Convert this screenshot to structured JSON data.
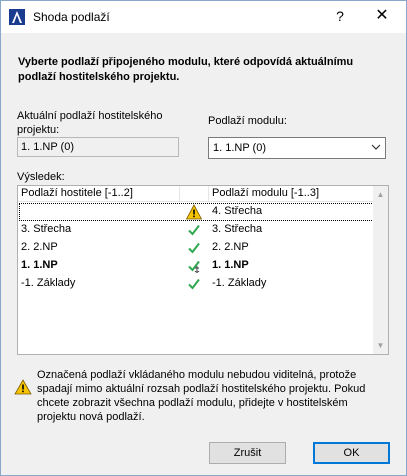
{
  "window": {
    "title": "Shoda podlaží",
    "help_label": "?",
    "close_label": "✕"
  },
  "instruction": "Vyberte podlaží připojeného modulu, které odpovídá aktuálnímu podlaží hostitelského projektu.",
  "current_storey": {
    "label": "Aktuální podlaží hostitelského projektu:",
    "value": "1. 1.NP (0)"
  },
  "module_storey": {
    "label": "Podlaží modulu:",
    "value": "1. 1.NP (0)"
  },
  "results": {
    "label": "Výsledek:",
    "columns": [
      "Podlaží hostitele [-1..2]",
      "Podlaží modulu [-1..3]"
    ],
    "rows": [
      {
        "host": "",
        "status": "warning",
        "module": "4. Střecha",
        "bold": false,
        "focused": true
      },
      {
        "host": "3. Střecha",
        "status": "check",
        "module": "3. Střecha",
        "bold": false,
        "focused": false
      },
      {
        "host": "2. 2.NP",
        "status": "check",
        "module": "2. 2.NP",
        "bold": false,
        "focused": false
      },
      {
        "host": "1. 1.NP",
        "status": "check-anchor",
        "module": "1. 1.NP",
        "bold": true,
        "focused": false
      },
      {
        "host": "-1. Základy",
        "status": "check",
        "module": "-1. Základy",
        "bold": false,
        "focused": false
      }
    ]
  },
  "warning_text": "Označená podlaží vkládaného modulu nebudou viditelná, protože spadají mimo aktuální rozsah podlaží hostitelského projektu. Pokud chcete zobrazit všechna podlaží modulu, přidejte v hostitelském projektu nová podlaží.",
  "buttons": {
    "cancel": "Zrušit",
    "ok": "OK"
  },
  "colors": {
    "check": "#2fa84f",
    "warning_fill": "#f6c400",
    "focus_border": "#0078d7"
  }
}
